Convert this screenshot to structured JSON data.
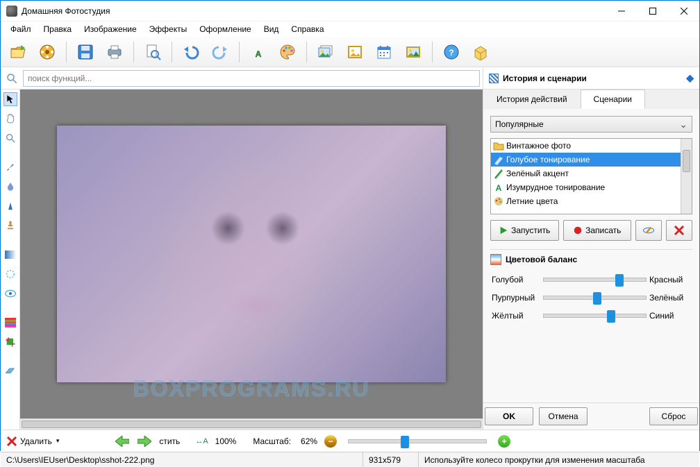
{
  "title": "Домашняя Фотостудия",
  "menu": [
    "Файл",
    "Правка",
    "Изображение",
    "Эффекты",
    "Оформление",
    "Вид",
    "Справка"
  ],
  "search": {
    "placeholder": "поиск функций..."
  },
  "rightHeader": "История и сценарии",
  "tabs": {
    "history": "История действий",
    "scenarios": "Сценарии"
  },
  "combo": "Популярные",
  "scenarios": [
    {
      "label": "Винтажное фото",
      "selected": false
    },
    {
      "label": "Голубое тонирование",
      "selected": true
    },
    {
      "label": "Зелёный акцент",
      "selected": false
    },
    {
      "label": "Изумрудное тонирование",
      "selected": false
    },
    {
      "label": "Летние цвета",
      "selected": false
    }
  ],
  "buttons": {
    "run": "Запустить",
    "record": "Записать"
  },
  "section": "Цветовой баланс",
  "sliders": [
    {
      "left": "Голубой",
      "right": "Красный",
      "pos": 70
    },
    {
      "left": "Пурпурный",
      "right": "Зелёный",
      "pos": 48
    },
    {
      "left": "Жёлтый",
      "right": "Синий",
      "pos": 62
    }
  ],
  "ok": "OK",
  "cancel": "Отмена",
  "reset": "Сброс",
  "bottom": {
    "delete": "Удалить",
    "fit": "стить",
    "hundred": "100%",
    "zoomLabel": "Масштаб:",
    "zoomValue": "62%"
  },
  "status": {
    "path": "C:\\Users\\IEUser\\Desktop\\sshot-222.png",
    "dim": "931x579",
    "msg": "Используйте колесо прокрутки для изменения масштаба"
  },
  "watermark": "BOXPROGRAMS.RU"
}
